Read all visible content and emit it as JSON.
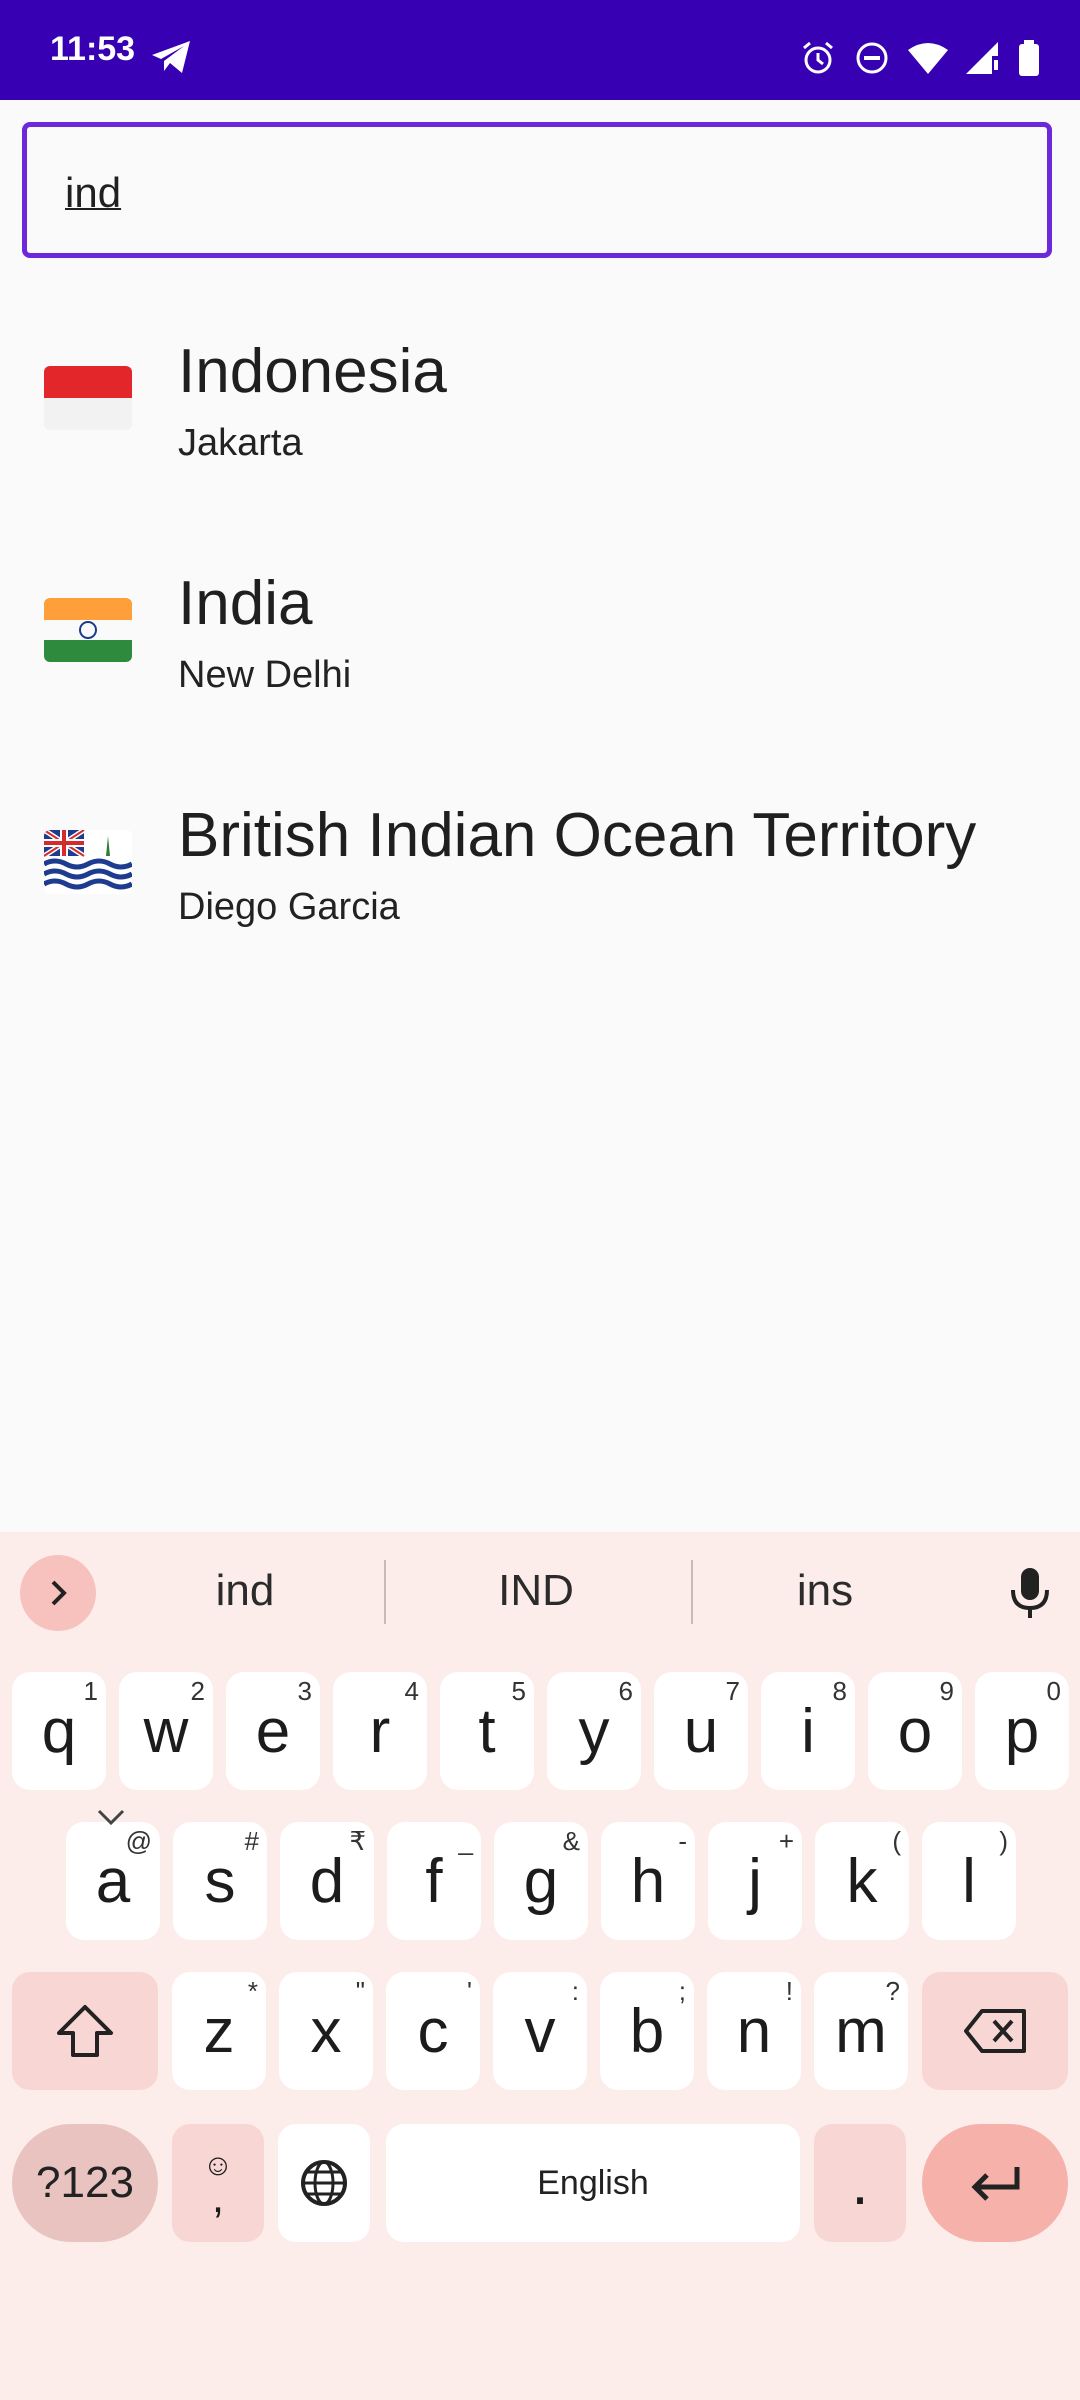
{
  "status_bar": {
    "time": "11:53",
    "icons": [
      "telegram-icon",
      "alarm-icon",
      "dnd-icon",
      "wifi-icon",
      "signal-icon",
      "battery-icon"
    ]
  },
  "search": {
    "value": "ind"
  },
  "results": [
    {
      "country": "Indonesia",
      "capital": "Jakarta",
      "flag": "indonesia-flag-icon"
    },
    {
      "country": "India",
      "capital": "New Delhi",
      "flag": "india-flag-icon"
    },
    {
      "country": "British Indian Ocean Territory",
      "capital": "Diego Garcia",
      "flag": "biot-flag-icon"
    }
  ],
  "keyboard": {
    "suggestions": [
      "ind",
      "IND",
      "ins"
    ],
    "row1": [
      {
        "k": "q",
        "h": "1"
      },
      {
        "k": "w",
        "h": "2"
      },
      {
        "k": "e",
        "h": "3"
      },
      {
        "k": "r",
        "h": "4"
      },
      {
        "k": "t",
        "h": "5"
      },
      {
        "k": "y",
        "h": "6"
      },
      {
        "k": "u",
        "h": "7"
      },
      {
        "k": "i",
        "h": "8"
      },
      {
        "k": "o",
        "h": "9"
      },
      {
        "k": "p",
        "h": "0"
      }
    ],
    "row2": [
      {
        "k": "a",
        "h": "@"
      },
      {
        "k": "s",
        "h": "#"
      },
      {
        "k": "d",
        "h": "₹"
      },
      {
        "k": "f",
        "h": "_"
      },
      {
        "k": "g",
        "h": "&"
      },
      {
        "k": "h",
        "h": "-"
      },
      {
        "k": "j",
        "h": "+"
      },
      {
        "k": "k",
        "h": "("
      },
      {
        "k": "l",
        "h": ")"
      }
    ],
    "row3": [
      {
        "k": "z",
        "h": "*"
      },
      {
        "k": "x",
        "h": "\""
      },
      {
        "k": "c",
        "h": "'"
      },
      {
        "k": "v",
        "h": ":"
      },
      {
        "k": "b",
        "h": ";"
      },
      {
        "k": "n",
        "h": "!"
      },
      {
        "k": "m",
        "h": "?"
      }
    ],
    "symbols_label": "?123",
    "emoji_comma_top": "☺",
    "emoji_comma_bottom": ",",
    "space_label": "English",
    "period_label": "."
  },
  "colors": {
    "status_bar": "#3700B3",
    "accent": "#6D28D9",
    "keyboard_bg": "#FCEDEB"
  }
}
